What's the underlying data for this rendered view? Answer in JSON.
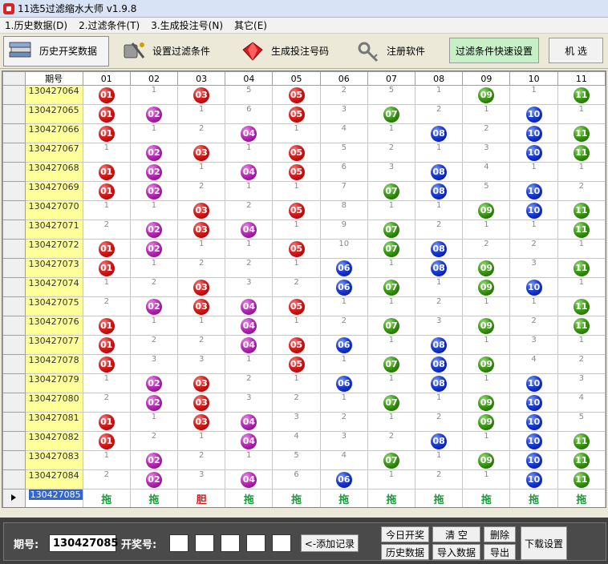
{
  "window": {
    "title": "11选5过滤缩水大师 v1.9.8"
  },
  "menu": [
    "1.历史数据(D)",
    "2.过滤条件(T)",
    "3.生成投注号(N)",
    "其它(E)"
  ],
  "toolbar": {
    "buttons": [
      {
        "label": "历史开奖数据",
        "icon": "books-icon"
      },
      {
        "label": "设置过滤条件",
        "icon": "tools-icon"
      },
      {
        "label": "生成投注号码",
        "icon": "red-gem-icon"
      },
      {
        "label": "注册软件",
        "icon": "key-icon"
      }
    ],
    "quick_filter": "过滤条件快速设置",
    "random_pick": "机 选"
  },
  "table": {
    "header_period": "期号",
    "columns": [
      "01",
      "02",
      "03",
      "04",
      "05",
      "06",
      "07",
      "08",
      "09",
      "10",
      "11"
    ],
    "rows": [
      {
        "period": "130427064",
        "cells": [
          "01",
          "1",
          "03",
          "5",
          "05",
          "2",
          "5",
          "1",
          "09",
          "1",
          "11"
        ]
      },
      {
        "period": "130427065",
        "cells": [
          "01",
          "02",
          "1",
          "6",
          "05",
          "3",
          "07",
          "2",
          "1",
          "10",
          "1"
        ]
      },
      {
        "period": "130427066",
        "cells": [
          "01",
          "1",
          "2",
          "04",
          "1",
          "4",
          "1",
          "08",
          "2",
          "10",
          "11"
        ]
      },
      {
        "period": "130427067",
        "cells": [
          "1",
          "02",
          "03",
          "1",
          "05",
          "5",
          "2",
          "1",
          "3",
          "10",
          "11"
        ]
      },
      {
        "period": "130427068",
        "cells": [
          "01",
          "02",
          "1",
          "04",
          "05",
          "6",
          "3",
          "08",
          "4",
          "1",
          "1"
        ]
      },
      {
        "period": "130427069",
        "cells": [
          "01",
          "02",
          "2",
          "1",
          "1",
          "7",
          "07",
          "08",
          "5",
          "10",
          "2"
        ]
      },
      {
        "period": "130427070",
        "cells": [
          "1",
          "1",
          "03",
          "2",
          "05",
          "8",
          "1",
          "1",
          "09",
          "10",
          "11"
        ]
      },
      {
        "period": "130427071",
        "cells": [
          "2",
          "02",
          "03",
          "04",
          "1",
          "9",
          "07",
          "2",
          "1",
          "1",
          "11"
        ]
      },
      {
        "period": "130427072",
        "cells": [
          "01",
          "02",
          "1",
          "1",
          "05",
          "10",
          "07",
          "08",
          "2",
          "2",
          "1"
        ]
      },
      {
        "period": "130427073",
        "cells": [
          "01",
          "1",
          "2",
          "2",
          "1",
          "06",
          "1",
          "08",
          "09",
          "3",
          "11"
        ]
      },
      {
        "period": "130427074",
        "cells": [
          "1",
          "2",
          "03",
          "3",
          "2",
          "06",
          "07",
          "1",
          "09",
          "10",
          "1"
        ]
      },
      {
        "period": "130427075",
        "cells": [
          "2",
          "02",
          "03",
          "04",
          "05",
          "1",
          "1",
          "2",
          "1",
          "1",
          "11"
        ]
      },
      {
        "period": "130427076",
        "cells": [
          "01",
          "1",
          "1",
          "04",
          "1",
          "2",
          "07",
          "3",
          "09",
          "2",
          "11"
        ]
      },
      {
        "period": "130427077",
        "cells": [
          "01",
          "2",
          "2",
          "04",
          "05",
          "06",
          "1",
          "08",
          "1",
          "3",
          "1"
        ]
      },
      {
        "period": "130427078",
        "cells": [
          "01",
          "3",
          "3",
          "1",
          "05",
          "1",
          "07",
          "08",
          "09",
          "4",
          "2"
        ]
      },
      {
        "period": "130427079",
        "cells": [
          "1",
          "02",
          "03",
          "2",
          "1",
          "06",
          "1",
          "08",
          "1",
          "10",
          "3"
        ]
      },
      {
        "period": "130427080",
        "cells": [
          "2",
          "02",
          "03",
          "3",
          "2",
          "1",
          "07",
          "1",
          "09",
          "10",
          "4"
        ]
      },
      {
        "period": "130427081",
        "cells": [
          "01",
          "1",
          "03",
          "04",
          "3",
          "2",
          "1",
          "2",
          "09",
          "10",
          "5"
        ]
      },
      {
        "period": "130427082",
        "cells": [
          "01",
          "2",
          "1",
          "04",
          "4",
          "3",
          "2",
          "08",
          "1",
          "10",
          "11"
        ]
      },
      {
        "period": "130427083",
        "cells": [
          "1",
          "02",
          "2",
          "1",
          "5",
          "4",
          "07",
          "1",
          "09",
          "10",
          "11"
        ]
      },
      {
        "period": "130427084",
        "cells": [
          "2",
          "02",
          "3",
          "04",
          "6",
          "06",
          "1",
          "2",
          "1",
          "10",
          "11"
        ]
      }
    ],
    "current_period": "130427085",
    "tags": [
      "拖",
      "拖",
      "胆",
      "拖",
      "拖",
      "拖",
      "拖",
      "拖",
      "拖",
      "拖",
      "拖"
    ],
    "ball_colors": {
      "01": "red",
      "03": "red",
      "05": "red",
      "02": "purple",
      "04": "purple",
      "07": "green",
      "09": "green",
      "11": "green",
      "06": "blue",
      "08": "blue",
      "10": "blue"
    }
  },
  "bottom": {
    "period_label": "期号:",
    "period_value": "130427085",
    "draw_label": "开奖号:",
    "add_record": "<-添加记录",
    "today_draw": "今日开奖",
    "clear": "清 空",
    "delete": "删除",
    "download_settings": "下载设置",
    "history_data": "历史数据",
    "import_data": "导入数据",
    "export": "导出"
  }
}
